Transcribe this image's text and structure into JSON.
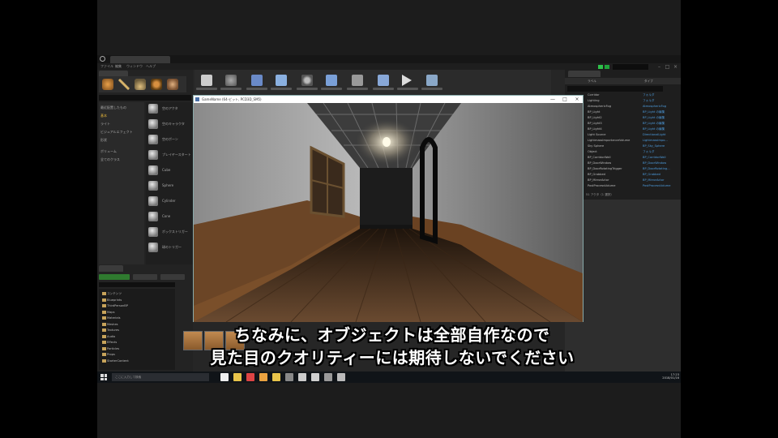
{
  "editor": {
    "menu": [
      "ファイル",
      "編集",
      "ウィンドウ",
      "ヘルプ"
    ],
    "modes_tab": "モード",
    "search_placeholder": "クラスを検索",
    "categories": [
      "最近配置したもの",
      "基本",
      "ライト",
      "ビジュアルエフェクト",
      "形状",
      "ボリューム",
      "全てのクラス"
    ],
    "active_category_index": 1,
    "place_items": [
      "空のアクタ",
      "空のキャラクタ",
      "空のポーン",
      "プレイヤースタート",
      "Cube",
      "Sphere",
      "Cylinder",
      "Cone",
      "ボックストリガー",
      "球のトリガー"
    ],
    "toolbar_buttons": [
      "保存",
      "ソース管理",
      "コンテンツ",
      "マーケットプレイス",
      "設定",
      "ブループリント",
      "シネマティックス",
      "ビルド",
      "プレイ",
      "起動"
    ]
  },
  "viewport": {
    "title": "GameName (64-ビット, PCD3D_SM5)",
    "controls": [
      "—",
      "□",
      "×"
    ]
  },
  "outliner": {
    "tab": "ワールドアウトライナ",
    "columns": [
      "ラベル",
      "タイプ"
    ],
    "rows": [
      {
        "name": "Corridor",
        "type": "フォルダ"
      },
      {
        "name": "Lighting",
        "type": "フォルダ"
      },
      {
        "name": "AtmosphericFog",
        "type": "AtmosphericFog"
      },
      {
        "name": "BP_Light",
        "type": "BP_Light の編集"
      },
      {
        "name": "BP_Light2",
        "type": "BP_Light の編集"
      },
      {
        "name": "BP_Light3",
        "type": "BP_Light の編集"
      },
      {
        "name": "BP_Light4",
        "type": "BP_Light の編集"
      },
      {
        "name": "Light Source",
        "type": "DirectionalLight"
      },
      {
        "name": "LightmassImportanceVolume",
        "type": "LightmassImpo..."
      },
      {
        "name": "Sky Sphere",
        "type": "BP_Sky_Sphere"
      },
      {
        "name": "Object",
        "type": "フォルダ"
      },
      {
        "name": "BP_CorridorWall",
        "type": "BP_CorridorWall"
      },
      {
        "name": "BP_DoorWindow",
        "type": "BP_DoorWindow"
      },
      {
        "name": "BP_DoorRotatingTrigger",
        "type": "BP_DoorRotating..."
      },
      {
        "name": "BP_Grabbed",
        "type": "BP_Grabbed"
      },
      {
        "name": "BP_MirrorActor",
        "type": "BP_MirrorActor"
      },
      {
        "name": "PostProcessVolume",
        "type": "PostProcessVolume"
      }
    ],
    "footer": "51 アクタ（1 選択）"
  },
  "content_browser": {
    "tab": "コンテンツブラウザ",
    "add_new": "新規追加",
    "import": "インポート",
    "save_all": "すべて保存",
    "folders": [
      "コンテンツ",
      "Blueprints",
      "ThirdPersonBP",
      "Maps",
      "Materials",
      "Meshes",
      "Textures",
      "Audio",
      "Effects",
      "Particles",
      "Props",
      "StarterContent"
    ],
    "footer": "エンジン コンテンツ"
  },
  "taskbar": {
    "search_placeholder": "ここに入力して検索",
    "time": "17:23",
    "date": "2018/01/16"
  },
  "subtitles": {
    "line1": "ちなみに、オブジェクトは全部自作なので",
    "line2": "見た目のクオリティーには期待しないでください"
  }
}
